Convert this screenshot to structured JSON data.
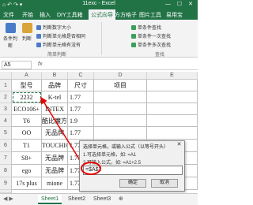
{
  "window": {
    "title": "11exc - Excel",
    "quick_access": "⌂ ↶ ↷ ▾",
    "controls": "— ☐ ✕"
  },
  "tabs": [
    "文件",
    "开始",
    "插入",
    "DIY工具箱",
    "公式向导",
    "方方格子",
    "图片工具",
    "易用宝"
  ],
  "ribbon": {
    "btn1": "条件判断",
    "btn2": "判断",
    "items_mid": [
      "判断数字大小",
      "判断单元格是否相同",
      "判断单元格有没有"
    ],
    "items_right": [
      "单条件查找",
      "单条件一次查找",
      "单条件多次查找"
    ],
    "groups": [
      "简单判断",
      "查找"
    ]
  },
  "formula_bar": {
    "name_box": "A5",
    "fx": "fx"
  },
  "columns": [
    "A",
    "B",
    "C",
    "D",
    "E"
  ],
  "rows": [
    "1",
    "2",
    "3",
    "4",
    "5",
    "6",
    "7",
    "8",
    "9",
    "10"
  ],
  "table": {
    "headers": [
      "型号",
      "品牌",
      "尺寸",
      "项目"
    ],
    "data": [
      [
        "2232",
        "K-tel",
        "1.77"
      ],
      [
        "ECO106+",
        "INTEX",
        "1.77"
      ],
      [
        "T6",
        "酷比魔方",
        "1.9"
      ],
      [
        "OO",
        "无品牌",
        "1.77"
      ],
      [
        "T1",
        "TOUCHIC",
        "1.77"
      ],
      [
        "S8+",
        "无品牌",
        "1.77"
      ],
      [
        "ego",
        "无品牌",
        "1.77"
      ],
      [
        "17s plus",
        "mione",
        "1.77"
      ]
    ]
  },
  "dialog": {
    "title": "选择单元格，或输入公式（以等号开头）",
    "line1": "1.可选择单元格，如: =A1",
    "line2": "2.可输入公式，如: =A1+2.5",
    "input_value": "=$A$2",
    "ok": "确定",
    "cancel": "取消",
    "close": "✕"
  },
  "sheets": [
    "Sheet1",
    "Sheet2",
    "Sheet3"
  ],
  "nav": "◀ ▶",
  "add_sheet": "⊕",
  "colors": {
    "excel_green": "#217346",
    "annotation_red": "#e60000"
  }
}
